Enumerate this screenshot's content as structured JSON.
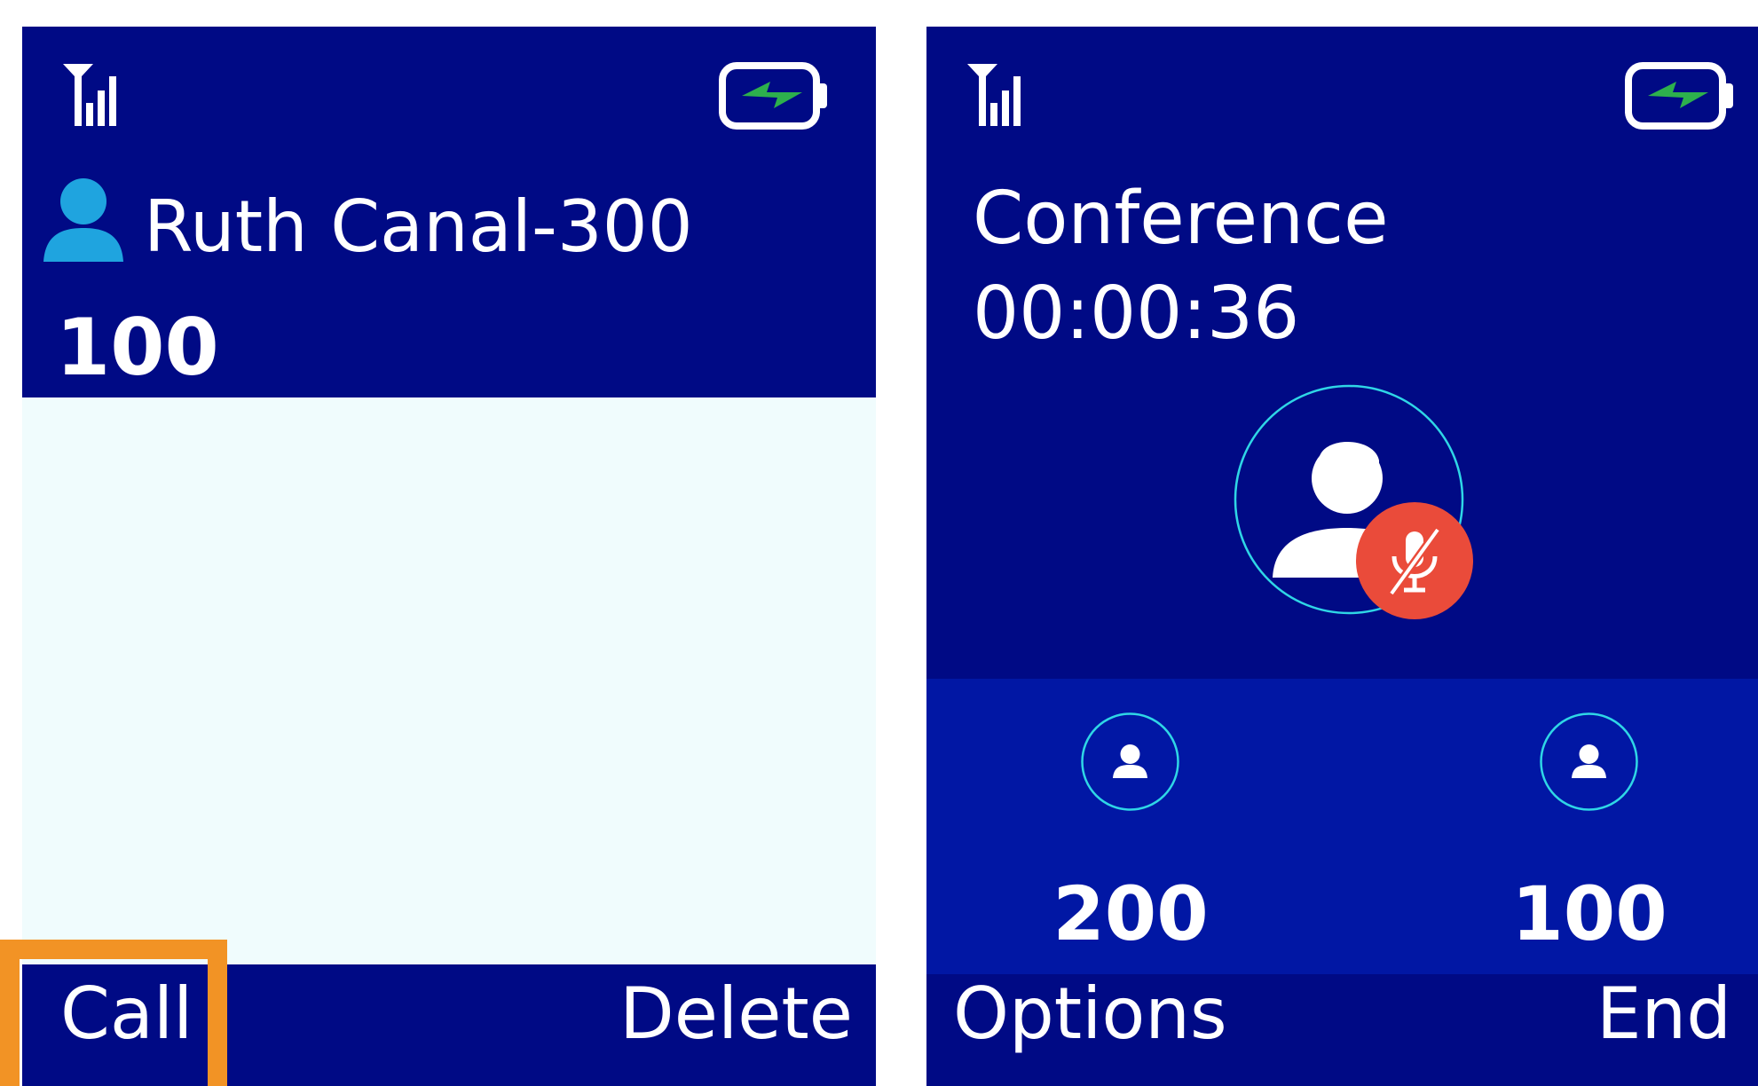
{
  "colors": {
    "header_background": "#000a85",
    "content_background": "#f0fcfd",
    "participants_background": "#0117a4",
    "contact_icon": "#1fa4df",
    "battery_bolt": "#2db04d",
    "mute_badge": "#ea4b3a",
    "avatar_ring": "#2fd6e6",
    "highlight": "#f29325"
  },
  "icons": {
    "signal": "signal-strength-icon",
    "battery": "battery-charging-icon",
    "contact": "contact-person-icon",
    "avatar": "person-avatar-icon",
    "mute": "microphone-muted-icon"
  },
  "dial_screen": {
    "contact_name": "Ruth Canal-300",
    "dialed_number": "100",
    "softkeys": {
      "left": "Call",
      "right": "Delete"
    }
  },
  "call_screen": {
    "title": "Conference",
    "timer": "00:00:36",
    "participants": [
      {
        "number": "200"
      },
      {
        "number": "100"
      }
    ],
    "softkeys": {
      "left": "Options",
      "right": "End"
    }
  }
}
